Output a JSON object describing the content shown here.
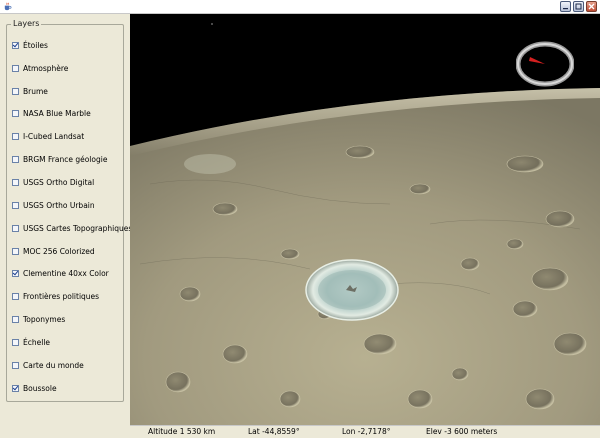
{
  "window": {
    "icon": "java-cup-icon",
    "buttons": [
      "minimize-icon",
      "maximize-icon",
      "close-icon"
    ]
  },
  "layers": {
    "title": "Layers",
    "items": [
      {
        "label": "Étoiles",
        "checked": true
      },
      {
        "label": "Atmosphère",
        "checked": false
      },
      {
        "label": "Brume",
        "checked": false
      },
      {
        "label": "NASA Blue Marble",
        "checked": false
      },
      {
        "label": "I-Cubed Landsat",
        "checked": false
      },
      {
        "label": "BRGM France géologie",
        "checked": false
      },
      {
        "label": "USGS Ortho Digital",
        "checked": false
      },
      {
        "label": "USGS Ortho Urbain",
        "checked": false
      },
      {
        "label": "USGS Cartes Topographiques",
        "checked": false
      },
      {
        "label": "MOC 256 Colorized",
        "checked": false
      },
      {
        "label": "Clementine 40xx Color",
        "checked": true
      },
      {
        "label": "Frontières politiques",
        "checked": false
      },
      {
        "label": "Toponymes",
        "checked": false
      },
      {
        "label": "Échelle",
        "checked": false
      },
      {
        "label": "Carte du monde",
        "checked": false
      },
      {
        "label": "Boussole",
        "checked": true
      }
    ]
  },
  "status": {
    "altitude": "Altitude   1 530 km",
    "lat": "Lat -44,8559°",
    "lon": "Lon -2,7178°",
    "elev": "Elev  -3 600 meters"
  },
  "colors": {
    "sky": "#000000",
    "moon_surface": "#a29c82",
    "compass_needle": "#d42020"
  }
}
